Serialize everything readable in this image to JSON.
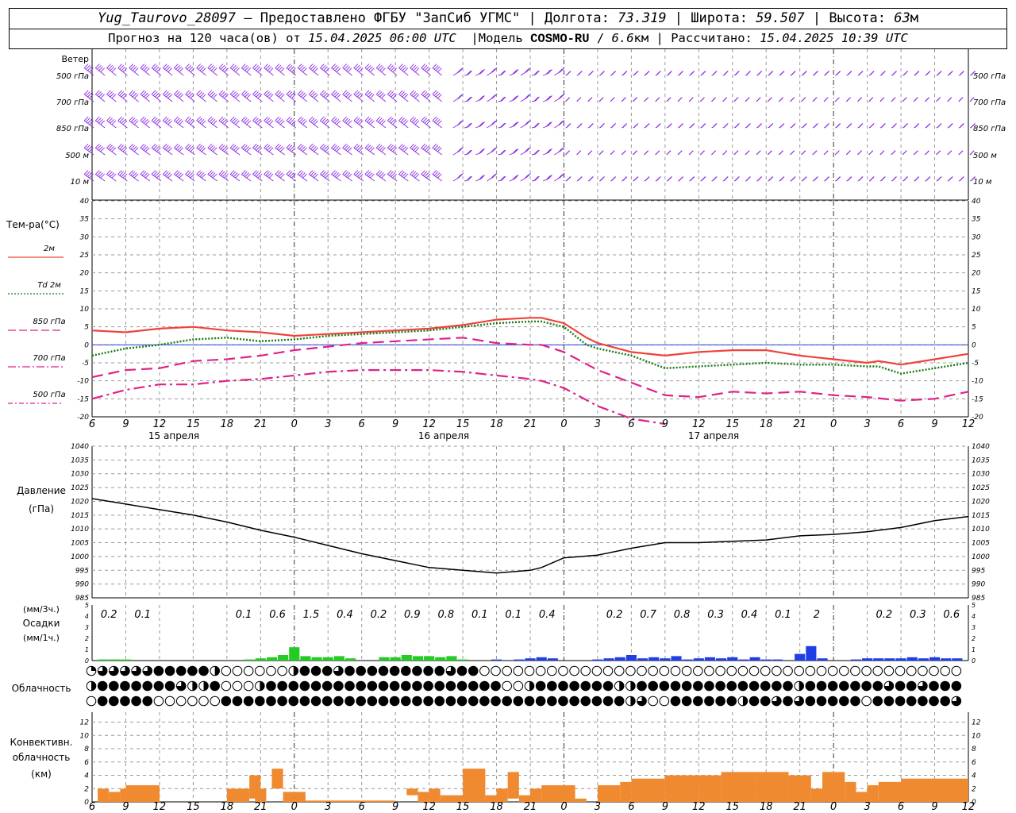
{
  "header": {
    "station": "Yug_Taurovo_28097",
    "provider": "– Предоставлено ФГБУ \"ЗапСиб УГМС\"",
    "lon_label": "Долгота:",
    "lon_value": "73.319",
    "lat_label": "Широта:",
    "lat_value": "59.507",
    "alt_label": "Высота:",
    "alt_value": "63",
    "alt_unit": "м",
    "forecast_prefix": "Прогноз на 120 часа(ов) от",
    "forecast_time": "15.04.2025 06:00 UTC",
    "model_label": "Модель",
    "model_name": "COSMO-RU",
    "model_res": "6.6",
    "model_res_unit": "км",
    "calc_label": "Рассчитано:",
    "calc_time": "15.04.2025 10:39 UTC"
  },
  "colors": {
    "t2m": "#f0423a",
    "td2m": "#157a15",
    "t850": "#e0218a",
    "t700": "#e0218a",
    "t500": "#e0218a",
    "wind": "#8a2be2",
    "pressure": "#000000",
    "precip_green": "#22cc22",
    "precip_blue": "#1f3fe6",
    "convective": "#f08a30",
    "grid": "#999999"
  },
  "wind_panel": {
    "title": "Ветер",
    "levels": [
      "500 гПа",
      "700 гПа",
      "850 гПа",
      "500 м",
      "10 м"
    ]
  },
  "temp_panel": {
    "title": "Тем-ра(°C)",
    "legend": [
      "2м",
      "Td 2м",
      "850 гПа",
      "700 гПа",
      "500 гПа"
    ]
  },
  "pressure_panel": {
    "title": "Давление",
    "unit": "(гПа)"
  },
  "precip_panel": {
    "unit3h": "(мм/3ч.)",
    "title": "Осадки",
    "unit1h": "(мм/1ч.)"
  },
  "cloud_panel": {
    "title": "Облачность"
  },
  "conv_panel": {
    "title": "Конвективн. облачность (км)"
  },
  "hours_axis": [
    "6",
    "9",
    "12",
    "15",
    "18",
    "21",
    "0",
    "3",
    "6",
    "9",
    "12",
    "15",
    "18",
    "21",
    "0",
    "3",
    "6",
    "9",
    "12",
    "15",
    "18",
    "21",
    "0",
    "3",
    "6",
    "9",
    "12"
  ],
  "date_labels": [
    "15 апреля",
    "16 апреля",
    "17 апреля"
  ],
  "chart_data": {
    "type": "line",
    "x_unit": "hours since 15.04.2025 06:00 UTC",
    "x_range": [
      0,
      78
    ],
    "temperature": {
      "ylim": [
        -20,
        40
      ],
      "yticks": [
        -20,
        -15,
        -10,
        -5,
        0,
        5,
        10,
        15,
        20,
        25,
        30,
        35,
        40
      ],
      "series": [
        {
          "name": "2м",
          "x": [
            0,
            3,
            6,
            9,
            12,
            15,
            18,
            21,
            24,
            27,
            30,
            33,
            36,
            39,
            40,
            42,
            44,
            45,
            48,
            51,
            54,
            57,
            60,
            63,
            66,
            69,
            70,
            72,
            75,
            78
          ],
          "values": [
            4,
            3.5,
            4.5,
            5,
            4,
            3.5,
            2.5,
            3,
            3.5,
            4,
            4.5,
            5.5,
            7,
            7.5,
            7.5,
            6,
            2,
            0.5,
            -2,
            -3,
            -2,
            -1.5,
            -1.5,
            -3,
            -4,
            -5,
            -4.5,
            -5.5,
            -4,
            -2.5
          ]
        },
        {
          "name": "Td 2м",
          "x": [
            0,
            3,
            6,
            9,
            12,
            15,
            18,
            21,
            24,
            27,
            30,
            33,
            36,
            39,
            40,
            42,
            44,
            45,
            48,
            51,
            54,
            57,
            60,
            63,
            66,
            69,
            70,
            72,
            75,
            78
          ],
          "values": [
            -3,
            -1,
            0,
            1.5,
            2,
            1,
            1.5,
            2.5,
            3,
            3.5,
            4,
            5,
            6,
            6.5,
            6.5,
            5,
            0,
            -1,
            -3,
            -6.5,
            -6,
            -5.5,
            -5,
            -5.5,
            -5.5,
            -6,
            -6,
            -8,
            -6.5,
            -5
          ]
        },
        {
          "name": "850 гПа",
          "x": [
            0,
            3,
            6,
            9,
            12,
            15,
            18,
            21,
            24,
            27,
            30,
            33,
            36,
            39,
            40,
            42,
            45,
            48,
            51,
            54,
            57,
            60,
            63,
            66,
            69,
            72,
            75,
            78
          ],
          "values": [
            -9,
            -7,
            -6.5,
            -4.5,
            -4,
            -3,
            -1.5,
            -0.5,
            0.5,
            1,
            1.5,
            2,
            0.5,
            0,
            0,
            -2,
            -7,
            -10.5,
            -14,
            -14.5,
            -13,
            -13.5,
            -13,
            -14,
            -14.5,
            -15.5,
            -15,
            -13
          ]
        },
        {
          "name": "700 гПа",
          "x": [
            0,
            3,
            6,
            9,
            12,
            15,
            18,
            21,
            24,
            27,
            30,
            33,
            36,
            39,
            40,
            42,
            45,
            48,
            51
          ],
          "values": [
            -15,
            -12.5,
            -11,
            -11,
            -10,
            -9.5,
            -8.5,
            -7.5,
            -7,
            -7,
            -7,
            -7.5,
            -8.5,
            -9.5,
            -10,
            -12,
            -17,
            -20.5,
            -22
          ]
        }
      ]
    },
    "pressure": {
      "ylim": [
        985,
        1040
      ],
      "yticks": [
        985,
        990,
        995,
        1000,
        1005,
        1010,
        1015,
        1020,
        1025,
        1030,
        1035,
        1040
      ],
      "x": [
        0,
        3,
        6,
        9,
        12,
        15,
        18,
        21,
        24,
        27,
        30,
        33,
        36,
        39,
        40,
        42,
        45,
        48,
        51,
        54,
        57,
        60,
        63,
        66,
        69,
        72,
        75,
        78
      ],
      "values": [
        1021,
        1019,
        1017,
        1015,
        1012.5,
        1009.5,
        1007,
        1004,
        1001,
        998.5,
        996,
        995,
        994,
        995,
        996,
        999.5,
        1000.5,
        1003,
        1005,
        1005,
        1005.5,
        1006,
        1007.5,
        1008,
        1009,
        1010.5,
        1013,
        1014.5
      ]
    },
    "precip_3h": [
      {
        "x": 1.5,
        "label": "0.2"
      },
      {
        "x": 4.5,
        "label": "0.1"
      },
      {
        "x": 13.5,
        "label": "0.1"
      },
      {
        "x": 16.5,
        "label": "0.6"
      },
      {
        "x": 19.5,
        "label": "1.5"
      },
      {
        "x": 22.5,
        "label": "0.4"
      },
      {
        "x": 25.5,
        "label": "0.2"
      },
      {
        "x": 28.5,
        "label": "0.9"
      },
      {
        "x": 31.5,
        "label": "0.8"
      },
      {
        "x": 34.5,
        "label": "0.1"
      },
      {
        "x": 37.5,
        "label": "0.1"
      },
      {
        "x": 40.5,
        "label": "0.4"
      },
      {
        "x": 46.5,
        "label": "0.2"
      },
      {
        "x": 49.5,
        "label": "0.7"
      },
      {
        "x": 52.5,
        "label": "0.8"
      },
      {
        "x": 55.5,
        "label": "0.3"
      },
      {
        "x": 58.5,
        "label": "0.4"
      },
      {
        "x": 61.5,
        "label": "0.1"
      },
      {
        "x": 64.5,
        "label": "2"
      },
      {
        "x": 70.5,
        "label": "0.2"
      },
      {
        "x": 73.5,
        "label": "0.3"
      },
      {
        "x": 76.5,
        "label": "0.6"
      }
    ],
    "precip_1h": {
      "ylim": [
        0,
        5
      ],
      "green_bars": [
        [
          1,
          0.1
        ],
        [
          2,
          0.1
        ],
        [
          3,
          0.1
        ],
        [
          14,
          0.1
        ],
        [
          15,
          0.2
        ],
        [
          16,
          0.3
        ],
        [
          17,
          0.5
        ],
        [
          18,
          1.2
        ],
        [
          19,
          0.4
        ],
        [
          20,
          0.3
        ],
        [
          21,
          0.3
        ],
        [
          22,
          0.4
        ],
        [
          23,
          0.2
        ],
        [
          26,
          0.3
        ],
        [
          27,
          0.3
        ],
        [
          28,
          0.5
        ],
        [
          29,
          0.4
        ],
        [
          30,
          0.4
        ],
        [
          31,
          0.3
        ],
        [
          32,
          0.4
        ],
        [
          33,
          0.1
        ]
      ],
      "blue_bars": [
        [
          36,
          0.1
        ],
        [
          38,
          0.1
        ],
        [
          39,
          0.2
        ],
        [
          40,
          0.3
        ],
        [
          41,
          0.2
        ],
        [
          45,
          0.1
        ],
        [
          46,
          0.2
        ],
        [
          47,
          0.3
        ],
        [
          48,
          0.5
        ],
        [
          49,
          0.2
        ],
        [
          50,
          0.3
        ],
        [
          51,
          0.2
        ],
        [
          52,
          0.4
        ],
        [
          53,
          0.1
        ],
        [
          54,
          0.2
        ],
        [
          55,
          0.3
        ],
        [
          56,
          0.2
        ],
        [
          57,
          0.3
        ],
        [
          58,
          0.1
        ],
        [
          59,
          0.3
        ],
        [
          60,
          0.1
        ],
        [
          61,
          0.1
        ],
        [
          63,
          0.6
        ],
        [
          64,
          1.3
        ],
        [
          65,
          0.2
        ],
        [
          68,
          0.1
        ],
        [
          69,
          0.2
        ],
        [
          70,
          0.2
        ],
        [
          71,
          0.2
        ],
        [
          72,
          0.2
        ],
        [
          73,
          0.3
        ],
        [
          74,
          0.2
        ],
        [
          75,
          0.3
        ],
        [
          76,
          0.2
        ],
        [
          77,
          0.2
        ]
      ]
    },
    "cloud_rows": [
      "cqqqqqbbbbbhoooooohbbbqbbbbbbbbbqbbooooooooooooooooooooooooooooooooooooooooo",
      "hbbbbbbbqhhbooohbbbbbbbbbbbbbbbbbbbbboohbbbbbbbhhbbbbbbbbbbbbbbhbbbbbbbqbbqbbbbbbb",
      "obbbbboooooobbbbbbbbbbbbbbbbbbbbbbbbbbbbbbbbbbbbhqoobbbbbbhbbqbqbbbbbobbbbbbbq"
    ],
    "convective": {
      "ylim": [
        0,
        13
      ],
      "yticks": [
        0,
        2,
        4,
        6,
        8,
        10,
        12
      ],
      "bars": [
        [
          0.5,
          1,
          2,
          2
        ],
        [
          1.5,
          1,
          1.5,
          1.5
        ],
        [
          2.5,
          1,
          2,
          2
        ],
        [
          3,
          3,
          2.5,
          2.5
        ],
        [
          5,
          1,
          1.5,
          1.5
        ],
        [
          12,
          2,
          2,
          2
        ],
        [
          14,
          1,
          3.5,
          4
        ],
        [
          14.5,
          1,
          2,
          2
        ],
        [
          16,
          1,
          3,
          5
        ],
        [
          17,
          1,
          1.5,
          1.5
        ],
        [
          18,
          1,
          1.5,
          1.5
        ],
        [
          19,
          6,
          0.2,
          0.2
        ],
        [
          25,
          2,
          0.2,
          0.2
        ],
        [
          28,
          1,
          1,
          2
        ],
        [
          29,
          1,
          1.5,
          1.5
        ],
        [
          30,
          1,
          2,
          2
        ],
        [
          31,
          2,
          1,
          1
        ],
        [
          33,
          2,
          5,
          5
        ],
        [
          35,
          1,
          1,
          1
        ],
        [
          36,
          1,
          2,
          2
        ],
        [
          37,
          1,
          4,
          4.5
        ],
        [
          38,
          1,
          1,
          1
        ],
        [
          39,
          1,
          2,
          2
        ],
        [
          40,
          3,
          2.5,
          2.5
        ],
        [
          43,
          1,
          0.5,
          0.5
        ],
        [
          45,
          2,
          2.5,
          2.5
        ],
        [
          47,
          1,
          3,
          3
        ],
        [
          48,
          3,
          3.5,
          3.5
        ],
        [
          51,
          3,
          4,
          4
        ],
        [
          54,
          2,
          4,
          4
        ],
        [
          56,
          3,
          4.5,
          4.5
        ],
        [
          59,
          3,
          4.5,
          4.5
        ],
        [
          62,
          2,
          4,
          4
        ],
        [
          64,
          1,
          2,
          2
        ],
        [
          65,
          2,
          4.5,
          4.5
        ],
        [
          67,
          1,
          3,
          3
        ],
        [
          68,
          1,
          1.5,
          1.5
        ],
        [
          69,
          1,
          2.5,
          2.5
        ],
        [
          70,
          2,
          3,
          3
        ],
        [
          72,
          3,
          3.5,
          3.5
        ],
        [
          75,
          3,
          3.5,
          3.5
        ]
      ]
    }
  }
}
